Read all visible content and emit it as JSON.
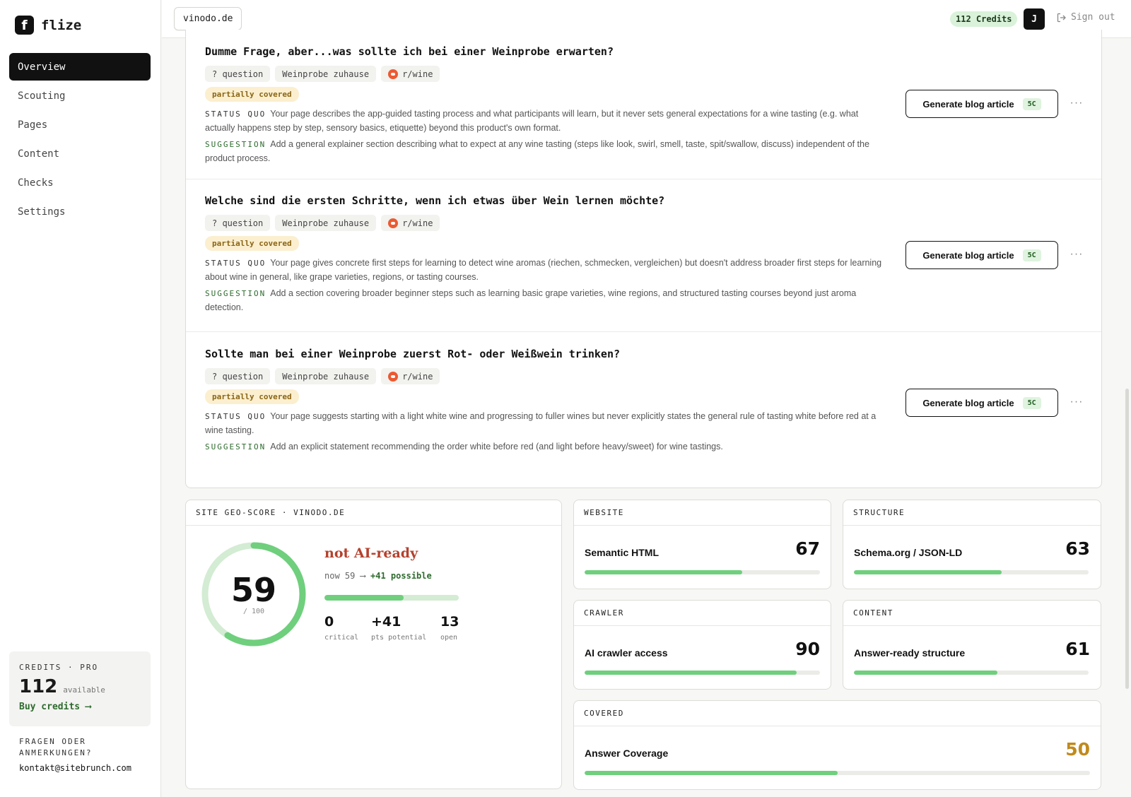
{
  "app": {
    "name": "flize",
    "logo_letter": "f"
  },
  "sidebar": {
    "items": [
      {
        "label": "Overview",
        "active": true
      },
      {
        "label": "Scouting"
      },
      {
        "label": "Pages"
      },
      {
        "label": "Content"
      },
      {
        "label": "Checks"
      },
      {
        "label": "Settings"
      }
    ],
    "credits": {
      "label": "CREDITS · PRO",
      "amount": "112",
      "available": "available",
      "buy": "Buy credits ⟶"
    },
    "contact": {
      "label": "FRAGEN ODER ANMERKUNGEN?",
      "email": "kontakt@sitebrunch.com"
    }
  },
  "header": {
    "site": "vinodo.de",
    "credits": "112 Credits",
    "avatar": "J",
    "signout": "Sign out"
  },
  "questions": [
    {
      "title": "Dumme Frage, aber...was sollte ich bei einer Weinprobe erwarten?",
      "tags": {
        "type": "? question",
        "topic": "Weinprobe zuhause",
        "source": "r/wine"
      },
      "status": "partially covered",
      "status_quo_label": "STATUS QUO",
      "status_quo": "Your page describes the app-guided tasting process and what participants will learn, but it never sets general expectations for a wine tasting (e.g. what actually happens step by step, sensory basics, etiquette) beyond this product's own format.",
      "suggestion_label": "SUGGESTION",
      "suggestion": "Add a general explainer section describing what to expect at any wine tasting (steps like look, swirl, smell, taste, spit/swallow, discuss) independent of the product process.",
      "button": "Generate blog article",
      "cost": "5C",
      "more": "···"
    },
    {
      "title": "Welche sind die ersten Schritte, wenn ich etwas über Wein lernen möchte?",
      "tags": {
        "type": "? question",
        "topic": "Weinprobe zuhause",
        "source": "r/wine"
      },
      "status": "partially covered",
      "status_quo_label": "STATUS QUO",
      "status_quo": "Your page gives concrete first steps for learning to detect wine aromas (riechen, schmecken, vergleichen) but doesn't address broader first steps for learning about wine in general, like grape varieties, regions, or tasting courses.",
      "suggestion_label": "SUGGESTION",
      "suggestion": "Add a section covering broader beginner steps such as learning basic grape varieties, wine regions, and structured tasting courses beyond just aroma detection.",
      "button": "Generate blog article",
      "cost": "5C",
      "more": "···"
    },
    {
      "title": "Sollte man bei einer Weinprobe zuerst Rot- oder Weißwein trinken?",
      "tags": {
        "type": "? question",
        "topic": "Weinprobe zuhause",
        "source": "r/wine"
      },
      "status": "partially covered",
      "status_quo_label": "STATUS QUO",
      "status_quo": "Your page suggests starting with a light white wine and progressing to fuller wines but never explicitly states the general rule of tasting white before red at a wine tasting.",
      "suggestion_label": "SUGGESTION",
      "suggestion": "Add an explicit statement recommending the order white before red (and light before heavy/sweet) for wine tastings.",
      "button": "Generate blog article",
      "cost": "5C",
      "more": "···"
    }
  ],
  "geo": {
    "header": "SITE GEO-SCORE · VINODO.DE",
    "score": "59",
    "score_value": 59,
    "max": "/ 100",
    "verdict": "not AI-ready",
    "now": "now 59 ⟶",
    "possible": "+41 possible",
    "progress_fraction": 0.59,
    "stats": [
      {
        "value": "0",
        "label": "critical"
      },
      {
        "value": "+41",
        "label": "pts potential"
      },
      {
        "value": "13",
        "label": "open"
      }
    ]
  },
  "metrics": [
    {
      "header": "WEBSITE",
      "name": "Semantic HTML",
      "value": 67
    },
    {
      "header": "STRUCTURE",
      "name": "Schema.org / JSON-LD",
      "value": 63
    },
    {
      "header": "CRAWLER",
      "name": "AI crawler access",
      "value": 90
    },
    {
      "header": "CONTENT",
      "name": "Answer-ready structure",
      "value": 61
    },
    {
      "header": "COVERED",
      "name": "Answer Coverage",
      "value": 50
    }
  ],
  "colors": {
    "accent_green": "#6fcf7d",
    "warning_amber": "#c08a1e",
    "danger_red": "#b5412d",
    "badge_bg": "#fbefcf"
  }
}
